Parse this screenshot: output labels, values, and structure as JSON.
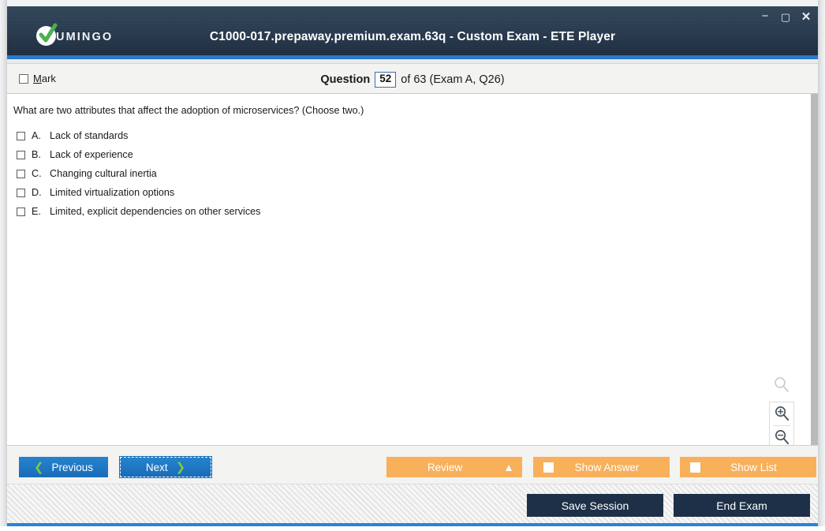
{
  "window": {
    "title": "C1000-017.prepaway.premium.exam.63q - Custom Exam - ETE Player",
    "brand": "UMINGO",
    "controls": {
      "minimize": "−",
      "maximize": "▢",
      "close": "✕"
    },
    "icons": {
      "logo": "check-circle-icon",
      "minimize": "minimize-icon",
      "maximize": "maximize-icon",
      "close": "close-icon"
    },
    "colors": {
      "titlebar_top": "#324659",
      "titlebar_bottom": "#1d2c3d",
      "accent_blue": "#2b82d8",
      "button_blue": "#1f78c4",
      "button_orange": "#f8b05a",
      "button_dark": "#1d3047",
      "chevron_green": "#7ac943"
    }
  },
  "question_header": {
    "mark_label_prefix": "M",
    "mark_label_rest": "ark",
    "mark_checked": false,
    "question_word": "Question",
    "question_number": "52",
    "of_text": "of 63 (Exam A, Q26)"
  },
  "question": {
    "stem": "What are two attributes that affect the adoption of microservices? (Choose two.)",
    "options": [
      {
        "letter": "A.",
        "text": "Lack of standards",
        "checked": false
      },
      {
        "letter": "B.",
        "text": "Lack of experience",
        "checked": false
      },
      {
        "letter": "C.",
        "text": "Changing cultural inertia",
        "checked": false
      },
      {
        "letter": "D.",
        "text": "Limited virtualization options",
        "checked": false
      },
      {
        "letter": "E.",
        "text": "Limited, explicit dependencies on other services",
        "checked": false
      }
    ]
  },
  "zoom_controls": {
    "reset_icon": "magnifier-icon",
    "zoom_in_icon": "magnifier-plus-icon",
    "zoom_out_icon": "magnifier-minus-icon"
  },
  "nav_bar": {
    "previous_label": "Previous",
    "previous_chevron": "❮",
    "next_label": "Next",
    "next_chevron": "❯",
    "next_focused": true,
    "review_label": "Review",
    "review_caret": "▲",
    "show_answer_label": "Show Answer",
    "show_answer_checked": false,
    "show_list_label": "Show List",
    "show_list_checked": false
  },
  "footer": {
    "save_session_label": "Save Session",
    "end_exam_label": "End Exam"
  }
}
